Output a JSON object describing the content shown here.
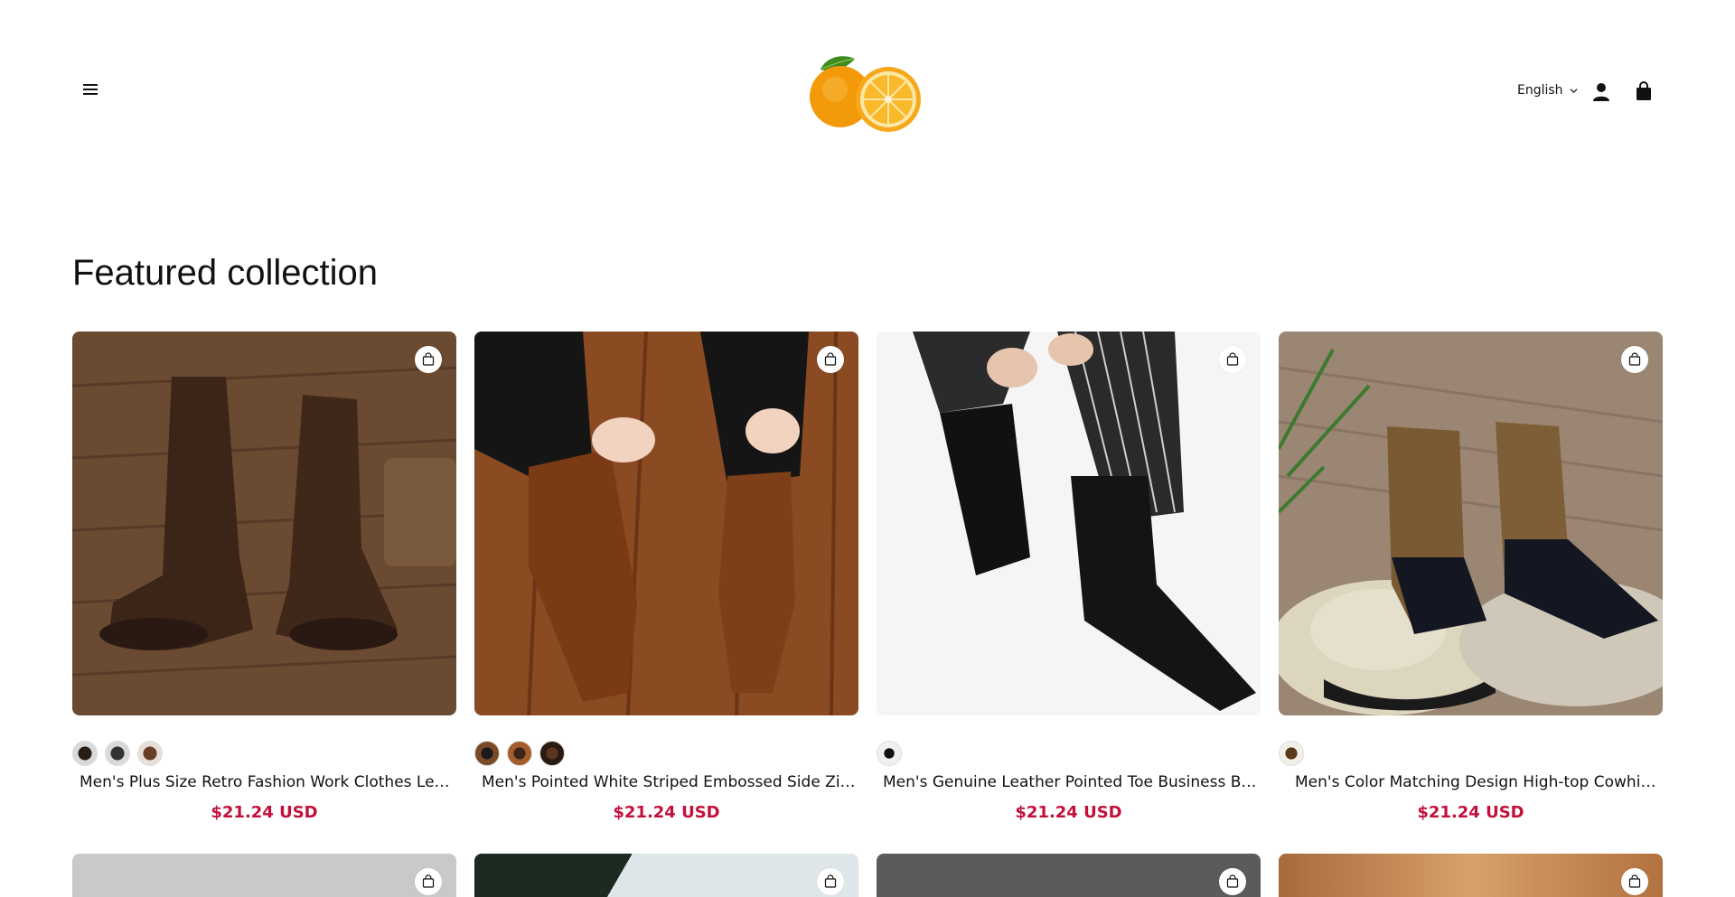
{
  "header": {
    "menu_icon": "hamburger-icon",
    "logo_icon": "orange-fruit-logo",
    "language": "English",
    "account_icon": "user-icon",
    "cart_icon": "shopping-bag-icon"
  },
  "section": {
    "title": "Featured collection"
  },
  "products": [
    {
      "title": "Men's Plus Size Retro Fashion Work Clothes Leather Boots",
      "price": "$21.24 USD",
      "swatch_count": 3
    },
    {
      "title": "Men's Pointed White Striped Embossed Side Zipper Leather Boots",
      "price": "$21.24 USD",
      "swatch_count": 3
    },
    {
      "title": "Men's Genuine Leather Pointed Toe Business British Chelsea Boots",
      "price": "$21.24 USD",
      "swatch_count": 1
    },
    {
      "title": "Men's Color Matching Design High-top Cowhide Boots",
      "price": "$21.24 USD",
      "swatch_count": 1
    }
  ],
  "colors": {
    "price": "#c2103b",
    "text": "#111111",
    "background": "#ffffff"
  }
}
